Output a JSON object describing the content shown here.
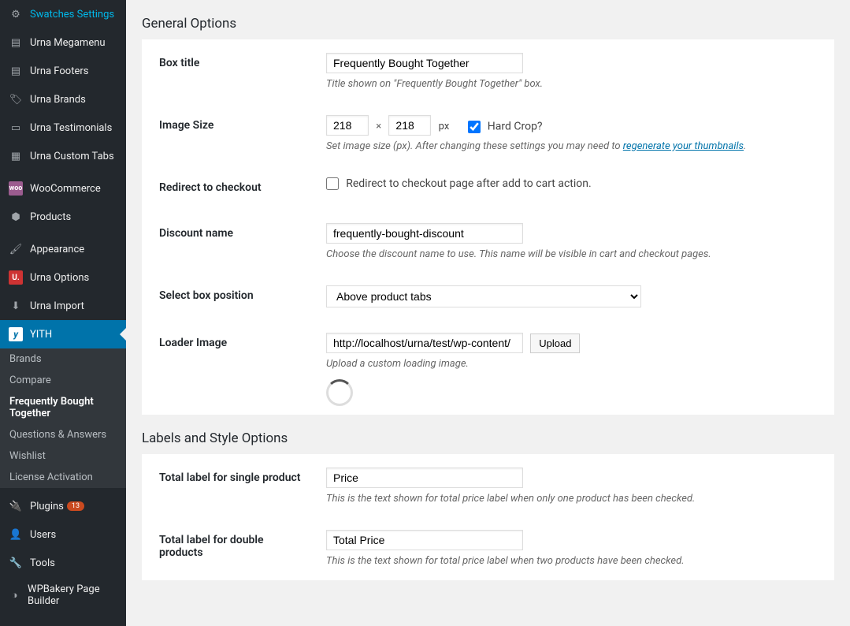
{
  "sidebar": {
    "items": [
      {
        "label": "Swatches Settings",
        "icon": "gear"
      },
      {
        "label": "Urna Megamenu",
        "icon": "layout"
      },
      {
        "label": "Urna Footers",
        "icon": "layout"
      },
      {
        "label": "Urna Brands",
        "icon": "tag"
      },
      {
        "label": "Urna Testimonials",
        "icon": "testimonial"
      },
      {
        "label": "Urna Custom Tabs",
        "icon": "grid"
      }
    ],
    "items2": [
      {
        "label": "WooCommerce",
        "icon": "woo"
      },
      {
        "label": "Products",
        "icon": "box"
      }
    ],
    "items3": [
      {
        "label": "Appearance",
        "icon": "brush"
      },
      {
        "label": "Urna Options",
        "icon": "u"
      },
      {
        "label": "Urna Import",
        "icon": "download"
      },
      {
        "label": "YITH",
        "icon": "yith",
        "active": true
      }
    ],
    "sub": [
      {
        "label": "Brands"
      },
      {
        "label": "Compare"
      },
      {
        "label": "Frequently Bought Together",
        "current": true
      },
      {
        "label": "Questions & Answers"
      },
      {
        "label": "Wishlist"
      },
      {
        "label": "License Activation"
      }
    ],
    "items4": [
      {
        "label": "Plugins",
        "icon": "plug",
        "badge": "13"
      },
      {
        "label": "Users",
        "icon": "user"
      },
      {
        "label": "Tools",
        "icon": "wrench"
      },
      {
        "label": "WPBakery Page Builder",
        "icon": "wpb"
      }
    ]
  },
  "section1_title": "General Options",
  "section2_title": "Labels and Style Options",
  "box_title": {
    "label": "Box title",
    "value": "Frequently Bought Together",
    "desc": "Title shown on \"Frequently Bought Together\" box."
  },
  "image_size": {
    "label": "Image Size",
    "w": "218",
    "h": "218",
    "px": "px",
    "hard_crop": "Hard Crop?",
    "desc_pre": "Set image size (px). After changing these settings you may need to ",
    "desc_link": "regenerate your thumbnails",
    "desc_post": "."
  },
  "redirect": {
    "label": "Redirect to checkout",
    "chk_label": "Redirect to checkout page after add to cart action."
  },
  "discount": {
    "label": "Discount name",
    "value": "frequently-bought-discount",
    "desc": "Choose the discount name to use. This name will be visible in cart and checkout pages."
  },
  "selectpos": {
    "label": "Select box position",
    "value": "Above product tabs"
  },
  "loader": {
    "label": "Loader Image",
    "value": "http://localhost/urna/test/wp-content/",
    "btn": "Upload",
    "desc": "Upload a custom loading image."
  },
  "total_single": {
    "label": "Total label for single product",
    "value": "Price",
    "desc": "This is the text shown for total price label when only one product has been checked."
  },
  "total_double": {
    "label": "Total label for double products",
    "value": "Total Price",
    "desc": "This is the text shown for total price label when two products have been checked."
  }
}
